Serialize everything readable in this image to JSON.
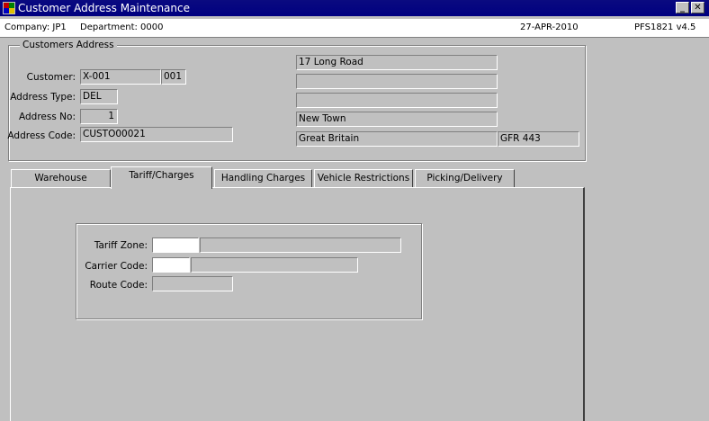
{
  "window": {
    "title": "Customer Address Maintenance",
    "minimize_label": "_",
    "close_label": "✕"
  },
  "info_bar": {
    "company": "Company:  JP1",
    "department": "Department:  0000",
    "date": "27-APR-2010",
    "program": "PFS1821  v4.5"
  },
  "customers_address": {
    "group_title": "Customers Address",
    "customer_label": "Customer:",
    "customer_code": "X-001",
    "customer_branch": "001",
    "address_type_label": "Address Type:",
    "address_type": "DEL",
    "address_no_label": "Address No:",
    "address_no": "1",
    "address_code_label": "Address Code:",
    "address_code": "CUSTO00021",
    "address_lines": [
      "17 Long Road",
      "",
      "",
      "New Town"
    ],
    "country": "Great Britain",
    "postcode": "GFR 443"
  },
  "tabs": [
    {
      "label": "Warehouse"
    },
    {
      "label": "Tariff/Charges"
    },
    {
      "label": "Handling Charges"
    },
    {
      "label": "Vehicle  Restrictions"
    },
    {
      "label": "Picking/Delivery"
    }
  ],
  "active_tab": "Tariff/Charges",
  "tariff": {
    "tariff_zone_label": "Tariff Zone:",
    "tariff_zone_code": "",
    "tariff_zone_desc": "",
    "carrier_code_label": "Carrier Code:",
    "carrier_code": "",
    "carrier_desc": "",
    "route_code_label": "Route Code:",
    "route_code": ""
  }
}
